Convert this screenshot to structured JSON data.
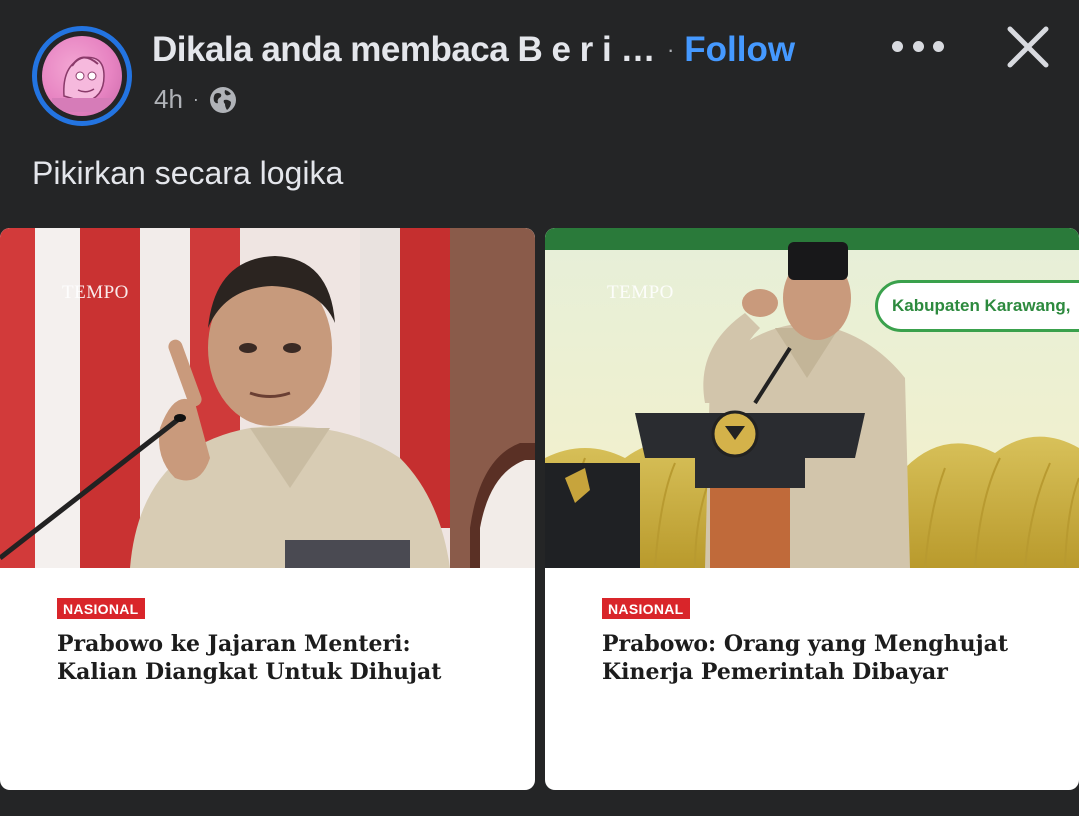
{
  "post": {
    "author_name": "Dikala anda membaca B e r i …",
    "follow_label": "Follow",
    "separator": "·",
    "time": "4h",
    "audience_icon": "globe-icon",
    "text": "Pikirkan secara logika"
  },
  "actions": {
    "more_icon": "more-horizontal-icon",
    "close_icon": "close-icon"
  },
  "cards": [
    {
      "watermark": "TEMPO",
      "category": "NASIONAL",
      "headline": "Prabowo ke Jajaran Menteri: Kalian Diangkat Untuk Dihujat"
    },
    {
      "watermark": "TEMPO",
      "category": "NASIONAL",
      "headline": "Prabowo: Orang yang Menghujat Kinerja Pemerintah Dibayar",
      "banner_text": "Kabupaten Karawang,"
    }
  ],
  "colors": {
    "background": "#242526",
    "follow": "#4599ff",
    "avatar_ring": "#2374e1",
    "badge": "#d9252a"
  }
}
